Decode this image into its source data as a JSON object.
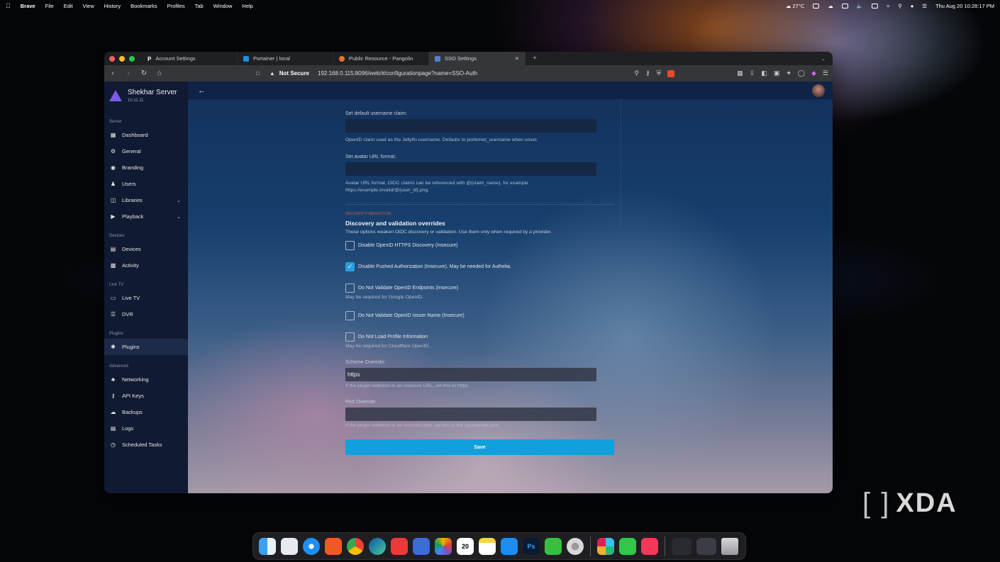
{
  "menubar": {
    "apple": "",
    "app": "Brave",
    "menus": [
      "File",
      "Edit",
      "View",
      "History",
      "Bookmarks",
      "Profiles",
      "Tab",
      "Window",
      "Help"
    ],
    "weather": "27°C",
    "datetime": "Thu Aug 20  10:28:17 PM"
  },
  "browser": {
    "tabs": [
      {
        "label": "Account Settings",
        "favicon": "P"
      },
      {
        "label": "Portainer | local",
        "favicon": "portainer"
      },
      {
        "label": "Public Resource - Pangolin",
        "favicon": "pangolin"
      },
      {
        "label": "SSO Settings",
        "favicon": "jellyfin"
      }
    ],
    "security": "Not Secure",
    "url": "192.168.0.115:8096/web/#/configurationpage?name=SSO-Auth"
  },
  "sidebar": {
    "server_name": "Shekhar Server",
    "version": "10.11.11",
    "sections": [
      {
        "title": "Server",
        "items": [
          {
            "label": "Dashboard",
            "icon": "dashboard-icon"
          },
          {
            "label": "General",
            "icon": "gear-icon"
          },
          {
            "label": "Branding",
            "icon": "palette-icon"
          },
          {
            "label": "Users",
            "icon": "users-icon"
          },
          {
            "label": "Libraries",
            "icon": "library-icon"
          },
          {
            "label": "Playback",
            "icon": "play-icon"
          }
        ]
      },
      {
        "title": "Devices",
        "items": [
          {
            "label": "Devices",
            "icon": "devices-icon"
          },
          {
            "label": "Activity",
            "icon": "activity-icon"
          }
        ]
      },
      {
        "title": "Live TV",
        "items": [
          {
            "label": "Live TV",
            "icon": "tv-icon"
          },
          {
            "label": "DVR",
            "icon": "dvr-icon"
          }
        ]
      },
      {
        "title": "Plugins",
        "items": [
          {
            "label": "Plugins",
            "icon": "puzzle-icon"
          }
        ]
      },
      {
        "title": "Advanced",
        "items": [
          {
            "label": "Networking",
            "icon": "network-icon"
          },
          {
            "label": "API Keys",
            "icon": "key-icon"
          },
          {
            "label": "Backups",
            "icon": "cloud-icon"
          },
          {
            "label": "Logs",
            "icon": "logs-icon"
          },
          {
            "label": "Scheduled Tasks",
            "icon": "clock-icon"
          }
        ]
      }
    ]
  },
  "form": {
    "username_claim_label": "Set default username claim:",
    "username_claim_value": "",
    "username_claim_hint": "OpenID claim used as the Jellyfin username. Defaults to preferred_username when unset.",
    "avatar_label": "Set avatar URL format:",
    "avatar_value": "",
    "avatar_hint": "Avatar URL format. OIDC claims can be referenced with @{claim_name}. for example https://example.invalid/@{user_id}.png.",
    "tag": "SECURITY-SENSITIVE",
    "section_title": "Discovery and validation overrides",
    "section_sub": "These options weaken OIDC discovery or validation. Use them only when required by a provider.",
    "checkboxes": [
      {
        "label": "Disable OpenID HTTPS Discovery (Insecure)",
        "checked": false,
        "hint": ""
      },
      {
        "label": "Disable Pushed Authorization (Insecure). May be needed for Authelia.",
        "checked": true,
        "hint": ""
      },
      {
        "label": "Do Not Validate OpenID Endpoints (Insecure)",
        "checked": false,
        "hint": "May be required for Google OpenID."
      },
      {
        "label": "Do Not Validate OpenID Issuer Name (Insecure)",
        "checked": false,
        "hint": ""
      },
      {
        "label": "Do Not Load Profile Information",
        "checked": false,
        "hint": "May be required for Cloudflare OpenID."
      }
    ],
    "scheme_label": "Scheme Override:",
    "scheme_value": "https",
    "scheme_hint": "If the plugin redirects to an insecure URL, set this to https.",
    "port_label": "Port Override:",
    "port_value": "",
    "port_hint": "If the plugin redirects to an incorrect port, set this to the appropriate port.",
    "save_label": "Save"
  },
  "dock": {
    "calendar_day": "20",
    "photoshop": "Ps"
  },
  "watermark": "XDA"
}
